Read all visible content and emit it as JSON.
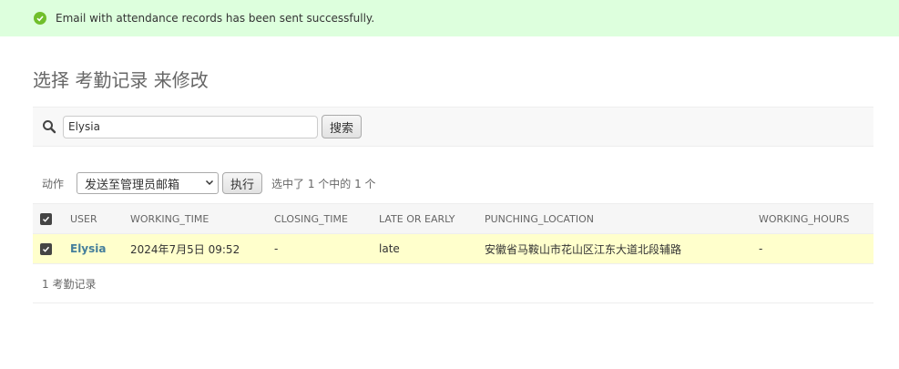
{
  "message": {
    "text": "Email with attendance records has been sent successfully.",
    "icon": "check-circle-icon",
    "color": "#70bf2b"
  },
  "title": "选择 考勤记录 来修改",
  "search": {
    "value": "Elysia",
    "button_label": "搜索",
    "icon": "search-icon"
  },
  "actions": {
    "label": "动作",
    "selected": "发送至管理员邮箱",
    "go_label": "执行",
    "counter": "选中了 1 个中的 1 个"
  },
  "table": {
    "columns": [
      "USER",
      "WORKING_TIME",
      "CLOSING_TIME",
      "LATE OR EARLY",
      "PUNCHING_LOCATION",
      "WORKING_HOURS"
    ],
    "rows": [
      {
        "user": "Elysia",
        "working_time": "2024年7月5日 09:52",
        "closing_time": "-",
        "late_or_early": "late",
        "punching_location": "安徽省马鞍山市花山区江东大道北段辅路",
        "working_hours": "-"
      }
    ],
    "header_checked": true,
    "row_checked": true
  },
  "paginator": "1 考勤记录",
  "colors": {
    "success_bg": "#ddffdd",
    "selected_row_bg": "#ffffcc",
    "link": "#447e9b"
  }
}
